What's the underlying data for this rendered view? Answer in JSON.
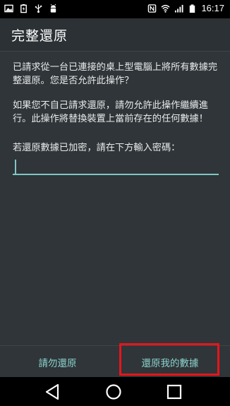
{
  "status_bar": {
    "time": "16:17",
    "left_icons": [
      "image-icon",
      "battery-saver-icon",
      "usb-icon",
      "android-debug-icon"
    ],
    "right_icons": [
      "nfc-icon",
      "wifi-icon",
      "signal-icon",
      "battery-icon"
    ]
  },
  "dialog": {
    "title": "完整還原",
    "paragraph1": "已請求從一台已連接的桌上型電腦上將所有數據完整還原。您是否允許此操作？",
    "paragraph2": "如果您不自己請求還原，請勿允許此操作繼續進行。此操作將替換裝置上當前存在的任何數據！",
    "paragraph3": "若還原數據已加密，請在下方輸入密碼：",
    "password_value": "",
    "deny_label": "請勿還原",
    "restore_label": "還原我的數據"
  },
  "colors": {
    "accent": "#8cd3cf",
    "highlight": "#e8141b",
    "background": "#2f3538"
  },
  "nav_bar": {
    "buttons": [
      "back-icon",
      "home-icon",
      "recent-apps-icon"
    ]
  }
}
